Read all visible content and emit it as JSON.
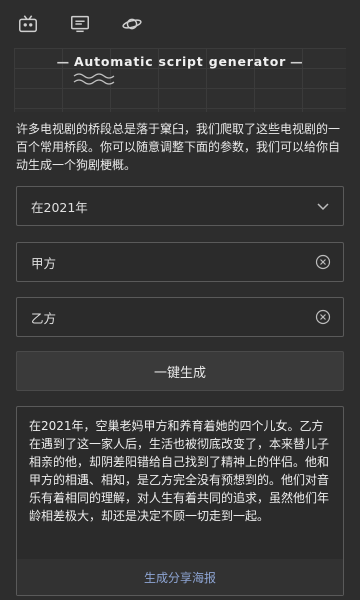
{
  "topbar": {
    "icons": [
      "tv-icon",
      "monitor-icon",
      "planet-icon"
    ]
  },
  "banner": {
    "title": "Automatic script generator",
    "dash": "—"
  },
  "description": "许多电视剧的桥段总是落于窠臼，我们爬取了这些电视剧的一百个常用桥段。你可以随意调整下面的参数，我们可以给你自动生成一个狗剧梗概。",
  "form": {
    "year_select": {
      "value": "在2021年"
    },
    "party_a": {
      "value": "甲方"
    },
    "party_b": {
      "value": "乙方"
    },
    "generate_label": "一键生成"
  },
  "result": {
    "text": "在2021年，空巢老妈甲方和养育着她的四个儿女。乙方在遇到了这一家人后，生活也被彻底改变了，本来替儿子相亲的他，却阴差阳错给自己找到了精神上的伴侣。他和甲方的相遇、相知，是乙方完全没有预想到的。他们对音乐有着相同的理解，对人生有着共同的追求，虽然他们年龄相差极大，却还是决定不顾一切走到一起。",
    "share_label": "生成分享海报"
  },
  "colors": {
    "background": "#2d2d2d",
    "field_border": "#5a5a5a",
    "link": "#8ea5d4"
  }
}
